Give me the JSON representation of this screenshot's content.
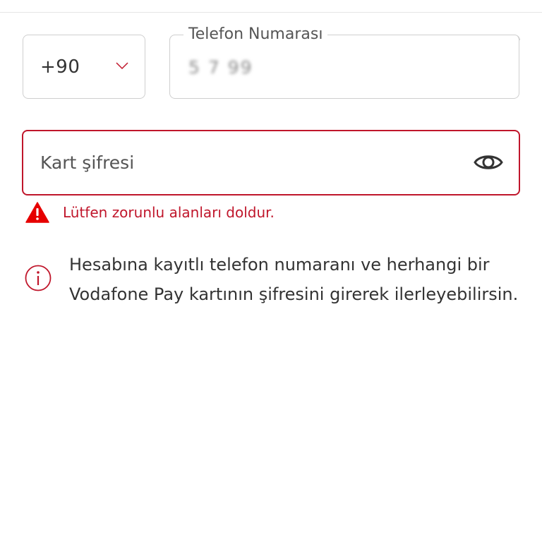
{
  "form": {
    "country_code": "+90",
    "phone_label": "Telefon Numarası",
    "phone_value": "5 7 99",
    "card_pin_placeholder": "Kart şifresi",
    "error_message": "Lütfen zorunlu alanları doldur.",
    "info_text": "Hesabına kayıtlı telefon numaranı ve herhangi bir Vodafone Pay kartının şifresini girerek ilerleyebilirsin."
  },
  "icons": {
    "country_dropdown": "chevron-down-icon",
    "password_visibility": "eye-icon",
    "error": "warning-icon",
    "info": "info-icon"
  },
  "colors": {
    "accent_red": "#c0162b",
    "border_gray": "#cfcfcf",
    "text_dark": "#333333"
  }
}
